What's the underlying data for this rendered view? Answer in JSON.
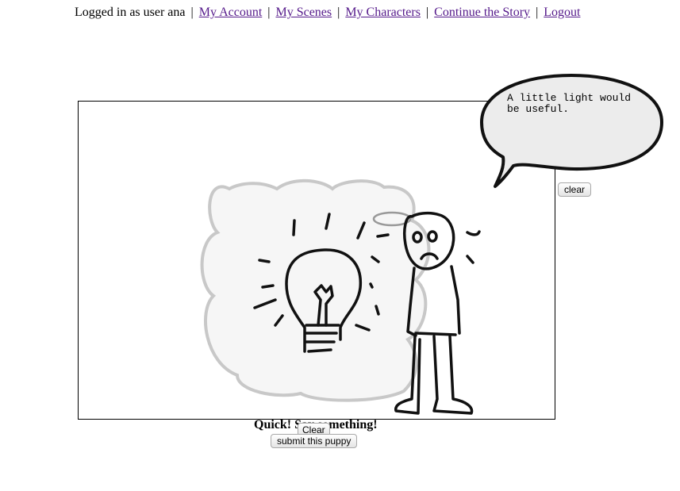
{
  "nav": {
    "logged_in_text": "Logged in as user ana",
    "separator": "|",
    "links": [
      "My Account",
      "My Scenes",
      "My Characters",
      "Continue the Story",
      "Logout"
    ]
  },
  "speech_bubble": {
    "text": "A little light would be useful."
  },
  "buttons": {
    "clear_bubble": "clear",
    "clear_canvas": "Clear",
    "submit": "submit this puppy"
  },
  "prompt_text": "Quick! Say something!"
}
